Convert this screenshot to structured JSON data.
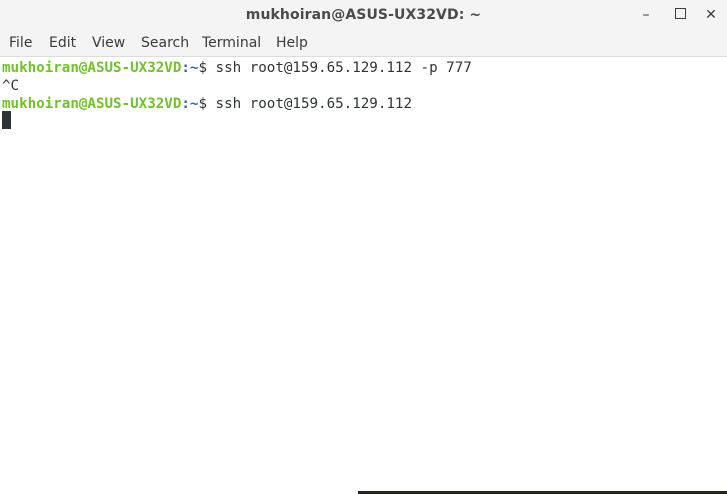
{
  "window": {
    "title": "mukhoiran@ASUS-UX32VD: ~",
    "controls": {
      "minimize": "–",
      "close": "✕"
    }
  },
  "menubar": {
    "items": [
      "File",
      "Edit",
      "View",
      "Search",
      "Terminal",
      "Help"
    ]
  },
  "terminal": {
    "lines": [
      {
        "user_host": "mukhoiran@ASUS-UX32VD",
        "path": ":~",
        "prompt_symbol": "$",
        "command": " ssh root@159.65.129.112 -p 777"
      },
      {
        "output": "^C"
      },
      {
        "user_host": "mukhoiran@ASUS-UX32VD",
        "path": ":~",
        "prompt_symbol": "$",
        "command": " ssh root@159.65.129.112"
      }
    ]
  },
  "colors": {
    "prompt_user": "#73c02d",
    "prompt_path": "#3465a4",
    "text": "#2e3436",
    "titlebar_bg": "#f4f4f4",
    "terminal_bg": "#ffffff"
  },
  "icons": {
    "minimize": "minimize-icon",
    "maximize": "maximize-icon",
    "close": "close-icon"
  }
}
